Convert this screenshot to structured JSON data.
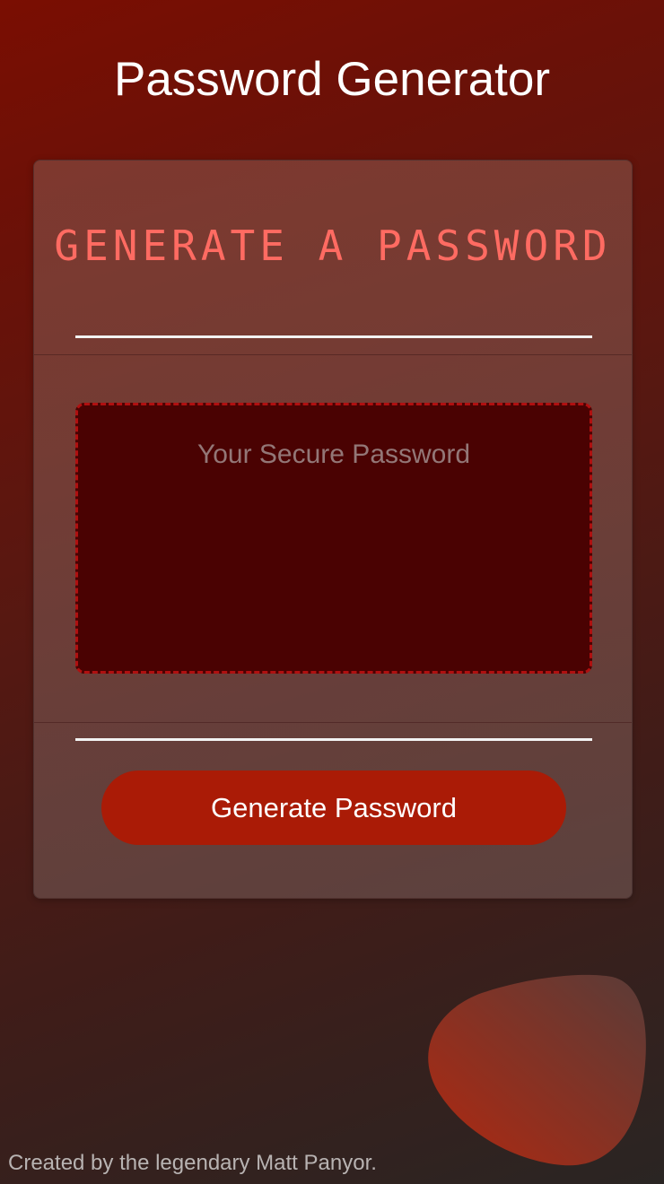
{
  "page": {
    "title": "Password Generator"
  },
  "card": {
    "heading": "Generate a Password",
    "password_placeholder": "Your Secure Password",
    "password_value": "",
    "generate_button_label": "Generate Password"
  },
  "footer": {
    "credit": "Created by the legendary Matt Panyor."
  },
  "colors": {
    "accent": "#ff6b62",
    "button": "#aa1b06",
    "password_bg": "#4a0202",
    "password_border": "#b01010"
  }
}
